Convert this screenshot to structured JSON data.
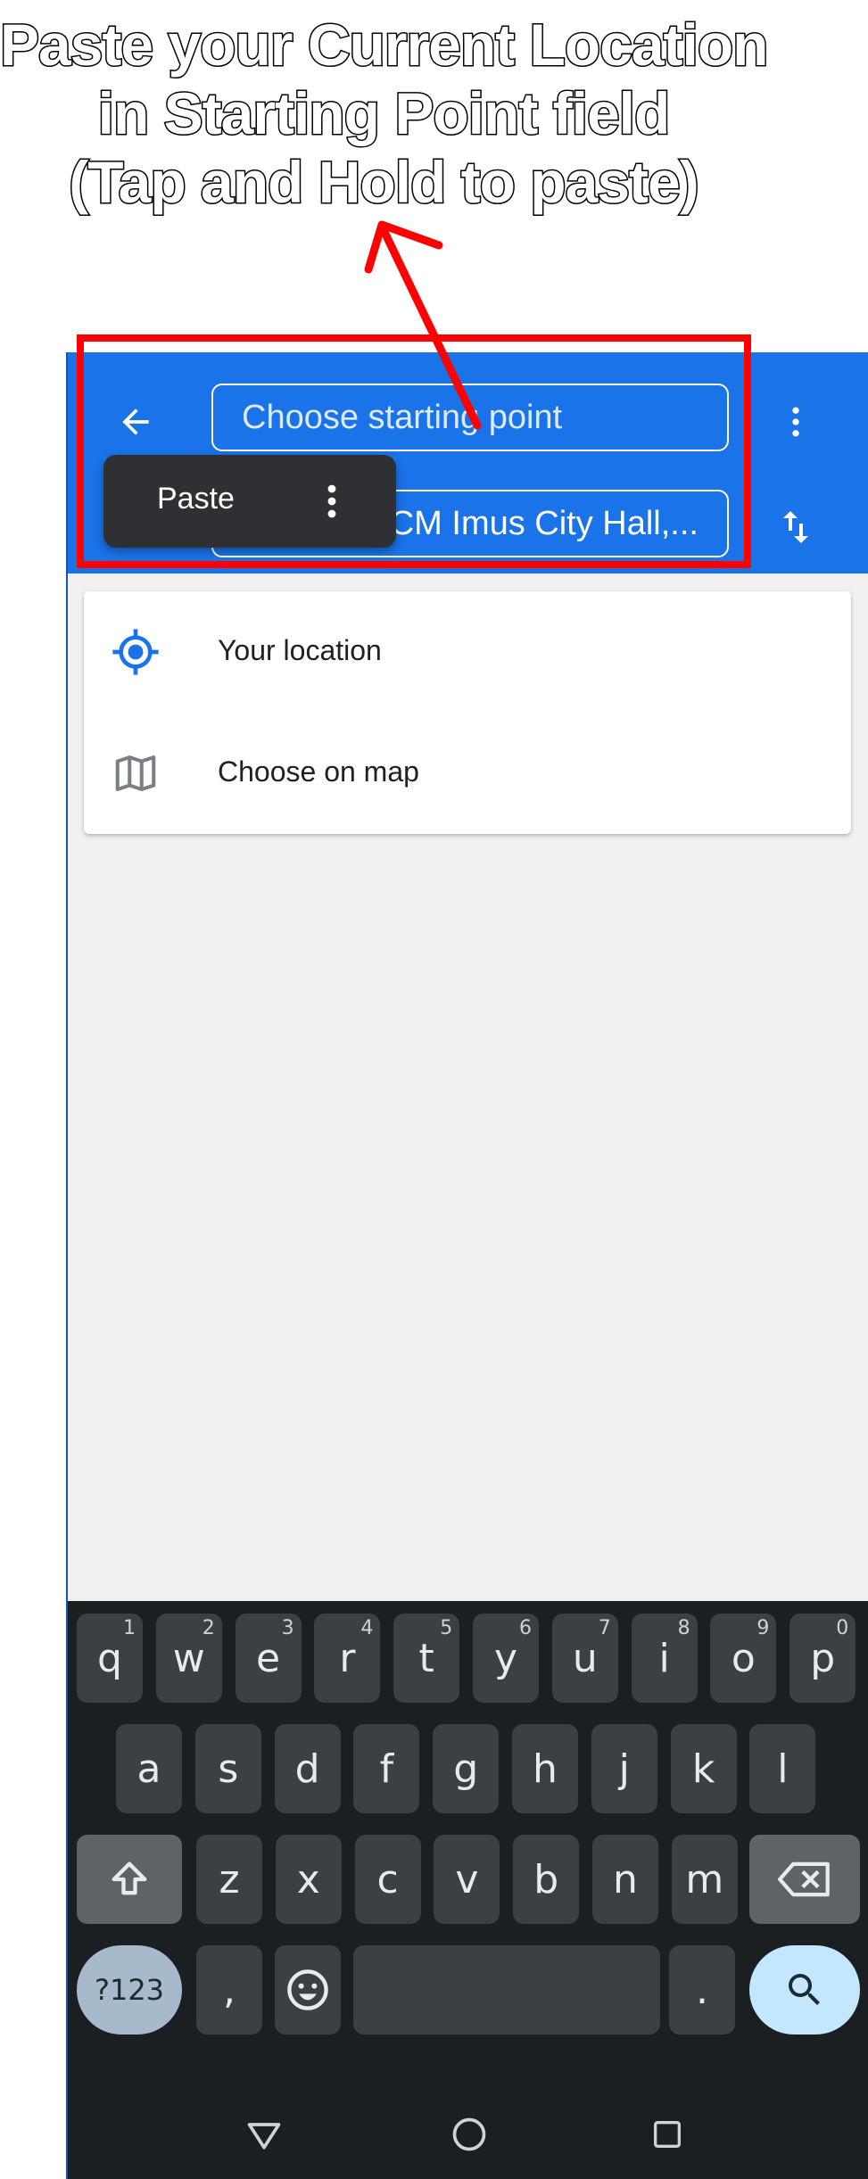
{
  "caption": {
    "line1": "Paste your Current Location",
    "line2": "in Starting Point field",
    "line3": "(Tap and Hold to paste)"
  },
  "directions": {
    "back_icon": "arrow-left-icon",
    "start_placeholder": "Choose starting point",
    "destination_value": "CWHP+CCM Imus City Hall,...",
    "more_icon": "more-vert-icon",
    "swap_icon": "swap-vert-icon"
  },
  "context_menu": {
    "paste_label": "Paste",
    "more_icon": "more-vert-icon"
  },
  "suggestions": [
    {
      "label": "Your location",
      "icon": "my-location-icon"
    },
    {
      "label": "Choose on map",
      "icon": "map-icon"
    }
  ],
  "keyboard": {
    "row1": [
      {
        "key": "q",
        "hint": "1"
      },
      {
        "key": "w",
        "hint": "2"
      },
      {
        "key": "e",
        "hint": "3"
      },
      {
        "key": "r",
        "hint": "4"
      },
      {
        "key": "t",
        "hint": "5"
      },
      {
        "key": "y",
        "hint": "6"
      },
      {
        "key": "u",
        "hint": "7"
      },
      {
        "key": "i",
        "hint": "8"
      },
      {
        "key": "o",
        "hint": "9"
      },
      {
        "key": "p",
        "hint": "0"
      }
    ],
    "row2": [
      "a",
      "s",
      "d",
      "f",
      "g",
      "h",
      "j",
      "k",
      "l"
    ],
    "row3": [
      "z",
      "x",
      "c",
      "v",
      "b",
      "n",
      "m"
    ],
    "symbols_label": "?123",
    "comma_label": ",",
    "period_label": ".",
    "shift_icon": "shift-icon",
    "backspace_icon": "backspace-icon",
    "emoji_icon": "emoji-icon",
    "search_icon": "search-icon"
  },
  "nav": {
    "back_icon": "nav-back-icon",
    "home_icon": "nav-home-icon",
    "recents_icon": "nav-recents-icon"
  },
  "colors": {
    "appbar": "#1a73e8",
    "highlight": "#ff0000",
    "location_blue": "#1a73e8"
  }
}
